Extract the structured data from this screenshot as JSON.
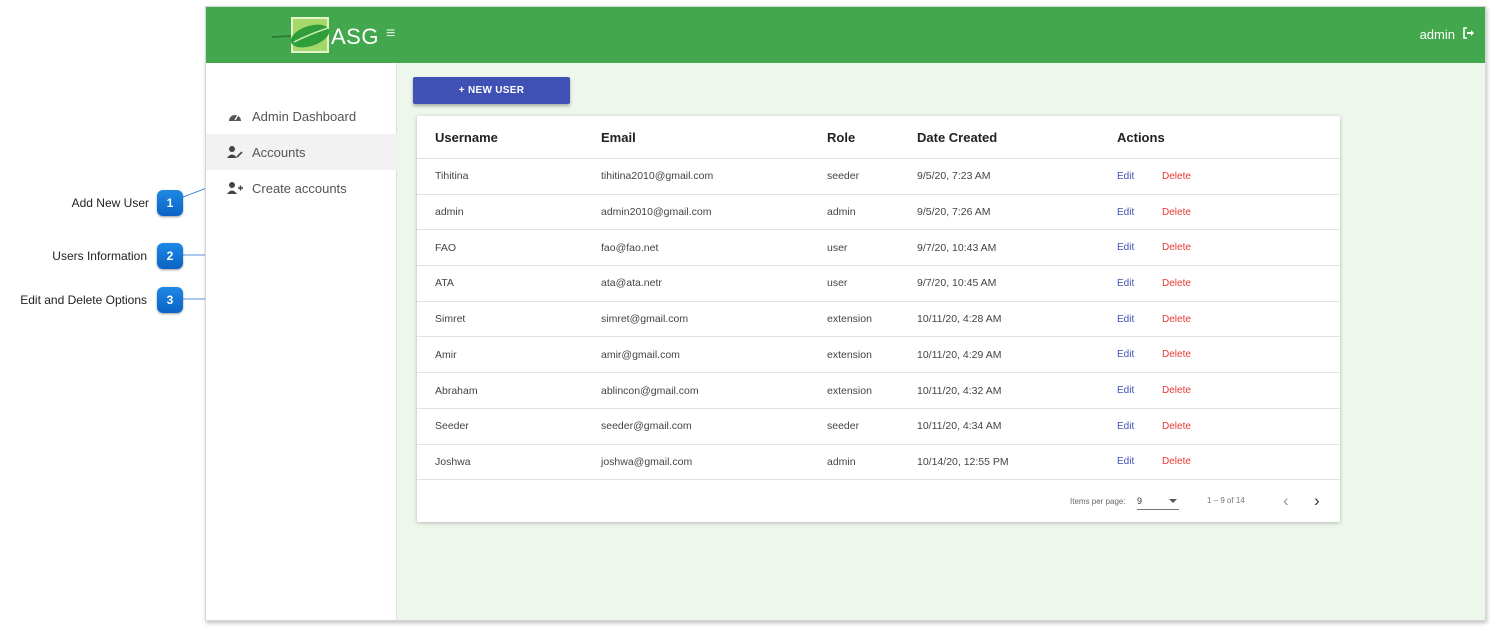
{
  "header": {
    "logo_text": "ASG",
    "user_name": "admin",
    "brand_color": "#43a84d"
  },
  "sidebar": {
    "items": [
      {
        "label": "Admin Dashboard",
        "icon": "dashboard-icon"
      },
      {
        "label": "Accounts",
        "icon": "user-edit-icon",
        "active": true
      },
      {
        "label": "Create accounts",
        "icon": "user-plus-icon"
      }
    ]
  },
  "new_user_button": {
    "label": "+ NEW USER",
    "color": "#3f51b5"
  },
  "table": {
    "columns": [
      "Username",
      "Email",
      "Role",
      "Date Created",
      "Actions"
    ],
    "rows": [
      {
        "username": "Tihitina",
        "email": "tihitina2010@gmail.com",
        "role": "seeder",
        "date": "9/5/20, 7:23 AM"
      },
      {
        "username": "admin",
        "email": "admin2010@gmail.com",
        "role": "admin",
        "date": "9/5/20, 7:26 AM"
      },
      {
        "username": "FAO",
        "email": "fao@fao.net",
        "role": "user",
        "date": "9/7/20, 10:43 AM"
      },
      {
        "username": "ATA",
        "email": "ata@ata.netr",
        "role": "user",
        "date": "9/7/20, 10:45 AM"
      },
      {
        "username": "Simret",
        "email": "simret@gmail.com",
        "role": "extension",
        "date": "10/11/20, 4:28 AM"
      },
      {
        "username": "Amir",
        "email": "amir@gmail.com",
        "role": "extension",
        "date": "10/11/20, 4:29 AM"
      },
      {
        "username": "Abraham",
        "email": "ablincon@gmail.com",
        "role": "extension",
        "date": "10/11/20, 4:32 AM"
      },
      {
        "username": "Seeder",
        "email": "seeder@gmail.com",
        "role": "seeder",
        "date": "10/11/20, 4:34 AM"
      },
      {
        "username": "Joshwa",
        "email": "joshwa@gmail.com",
        "role": "admin",
        "date": "10/14/20, 12:55 PM"
      }
    ],
    "edit_label": "Edit",
    "delete_label": "Delete",
    "edit_color": "#3f51b5",
    "delete_color": "#e53935"
  },
  "paginator": {
    "items_per_page_label": "Items per page:",
    "items_per_page_value": "9",
    "range_label": "1 – 9 of 14"
  },
  "callouts": [
    {
      "number": "1",
      "label": "Add New User"
    },
    {
      "number": "2",
      "label": "Users Information"
    },
    {
      "number": "3",
      "label": "Edit and Delete Options"
    }
  ]
}
